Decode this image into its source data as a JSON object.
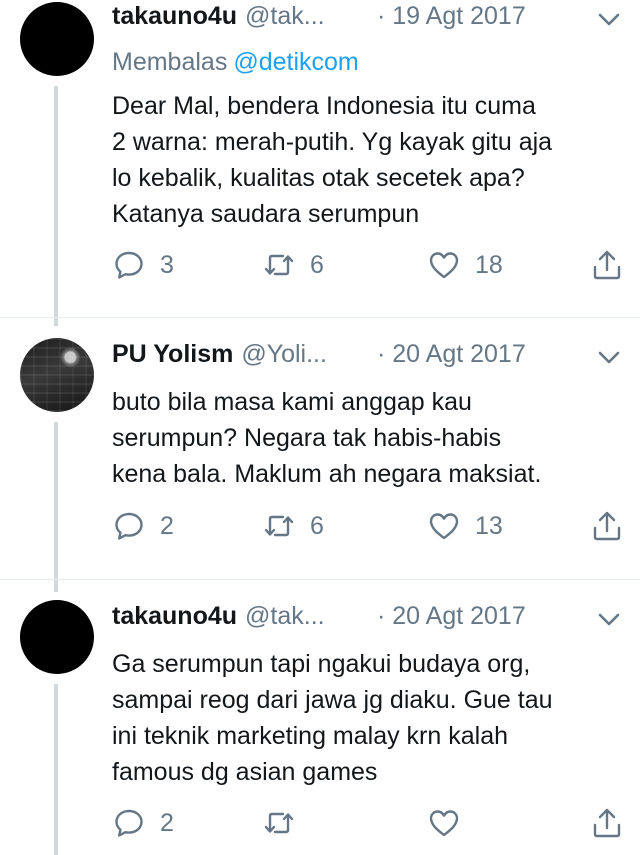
{
  "colors": {
    "link": "#1da1f2",
    "muted": "#657786",
    "text": "#14171a",
    "thread_line": "#cfd9de"
  },
  "tweets": [
    {
      "name": "takauno4u",
      "handle": "@tak...",
      "date": "· 19 Agt 2017",
      "reply_label": "Membalas",
      "reply_to": "@detikcom",
      "text": "Dear Mal, bendera Indonesia itu cuma\n2 warna: merah-putih. Yg kayak gitu aja\nlo kebalik, kualitas otak secetek apa?\nKatanya saudara serumpun",
      "replies": "3",
      "retweets": "6",
      "likes": "18"
    },
    {
      "name": "PU Yolism",
      "handle": "@Yoli...",
      "date": "· 20 Agt 2017",
      "text": "buto bila masa kami anggap kau\nserumpun? Negara tak habis-habis\nkena bala. Maklum ah negara maksiat.",
      "replies": "2",
      "retweets": "6",
      "likes": "13"
    },
    {
      "name": "takauno4u",
      "handle": "@tak...",
      "date": "· 20 Agt 2017",
      "text": "Ga serumpun tapi ngakui budaya org,\nsampai reog dari jawa jg diaku. Gue tau\nini teknik marketing malay krn kalah\nfamous dg asian games",
      "replies": "2",
      "retweets": "",
      "likes": ""
    }
  ]
}
